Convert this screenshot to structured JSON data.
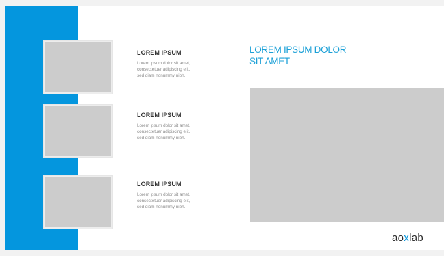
{
  "slide": {
    "title_lines": [
      "LOREM IPSUM DOLOR",
      "SIT AMET"
    ],
    "items": [
      {
        "heading": "LOREM IPSUM",
        "body_lines": [
          "Lorem ipsum dolor sit amet,",
          "consectetuer adipiscing elit,",
          "sed diam nonummy nibh."
        ]
      },
      {
        "heading": "LOREM IPSUM",
        "body_lines": [
          "Lorem ipsum dolor sit amet,",
          "consectetuer adipiscing elit,",
          "sed diam nonummy nibh."
        ]
      },
      {
        "heading": "LOREM IPSUM",
        "body_lines": [
          "Lorem ipsum dolor sit amet,",
          "consectetuer adipiscing elit,",
          "sed diam nonummy nibh."
        ]
      }
    ],
    "logo": {
      "part1": "ao",
      "part2": "x",
      "part3": "lab"
    }
  },
  "colors": {
    "accent_blue": "#0496de",
    "title_blue": "#1ba0d7",
    "placeholder_gray": "#cccccc",
    "heading_dark": "#333333",
    "body_gray": "#8c8c8c"
  }
}
